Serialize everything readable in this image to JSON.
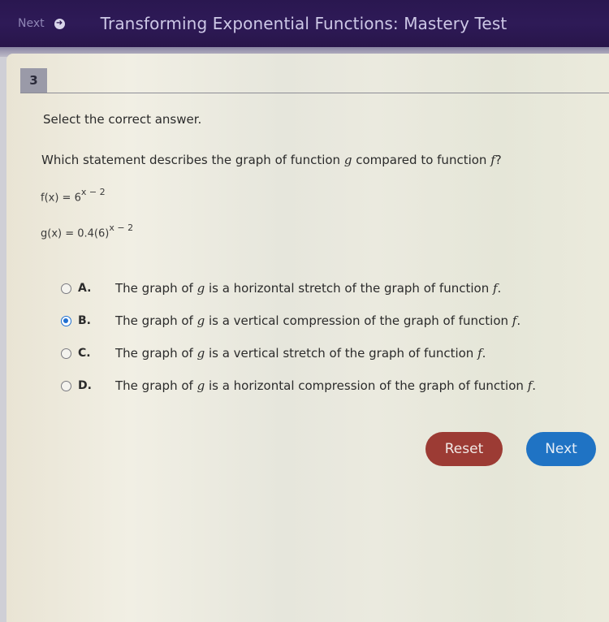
{
  "header": {
    "next_label": "Next",
    "next_icon": "arrow-circle-right-icon",
    "title": "Transforming Exponential Functions: Mastery Test"
  },
  "question": {
    "number": "3",
    "instruction": "Select the correct answer.",
    "prompt_before_g": "Which statement describes the graph of function ",
    "prompt_g": "g",
    "prompt_middle": " compared to function ",
    "prompt_f": "f",
    "prompt_end": "?",
    "equations": {
      "f_lhs": "f(x) = 6",
      "f_exp": "x − 2",
      "g_lhs": "g(x) = 0.4(6)",
      "g_exp": "x − 2"
    },
    "options": [
      {
        "letter": "A.",
        "text_before": "The graph of ",
        "var": "g",
        "text_after": " is a horizontal stretch of the graph of function ",
        "end_var": "f",
        "period": ".",
        "selected": false
      },
      {
        "letter": "B.",
        "text_before": "The graph of ",
        "var": "g",
        "text_after": " is a vertical compression of the graph of function ",
        "end_var": "f",
        "period": ".",
        "selected": true
      },
      {
        "letter": "C.",
        "text_before": "The graph of ",
        "var": "g",
        "text_after": " is a vertical stretch of the graph of function ",
        "end_var": "f",
        "period": ".",
        "selected": false
      },
      {
        "letter": "D.",
        "text_before": "The graph of ",
        "var": "g",
        "text_after": " is a horizontal compression of the graph of function ",
        "end_var": "f",
        "period": ".",
        "selected": false
      }
    ]
  },
  "buttons": {
    "reset_label": "Reset",
    "next_label": "Next"
  },
  "colors": {
    "header_bg": "#2e1a57",
    "selected_radio": "#1f6fd1",
    "reset_button": "#9c3b34",
    "next_button": "#1f73c4"
  }
}
